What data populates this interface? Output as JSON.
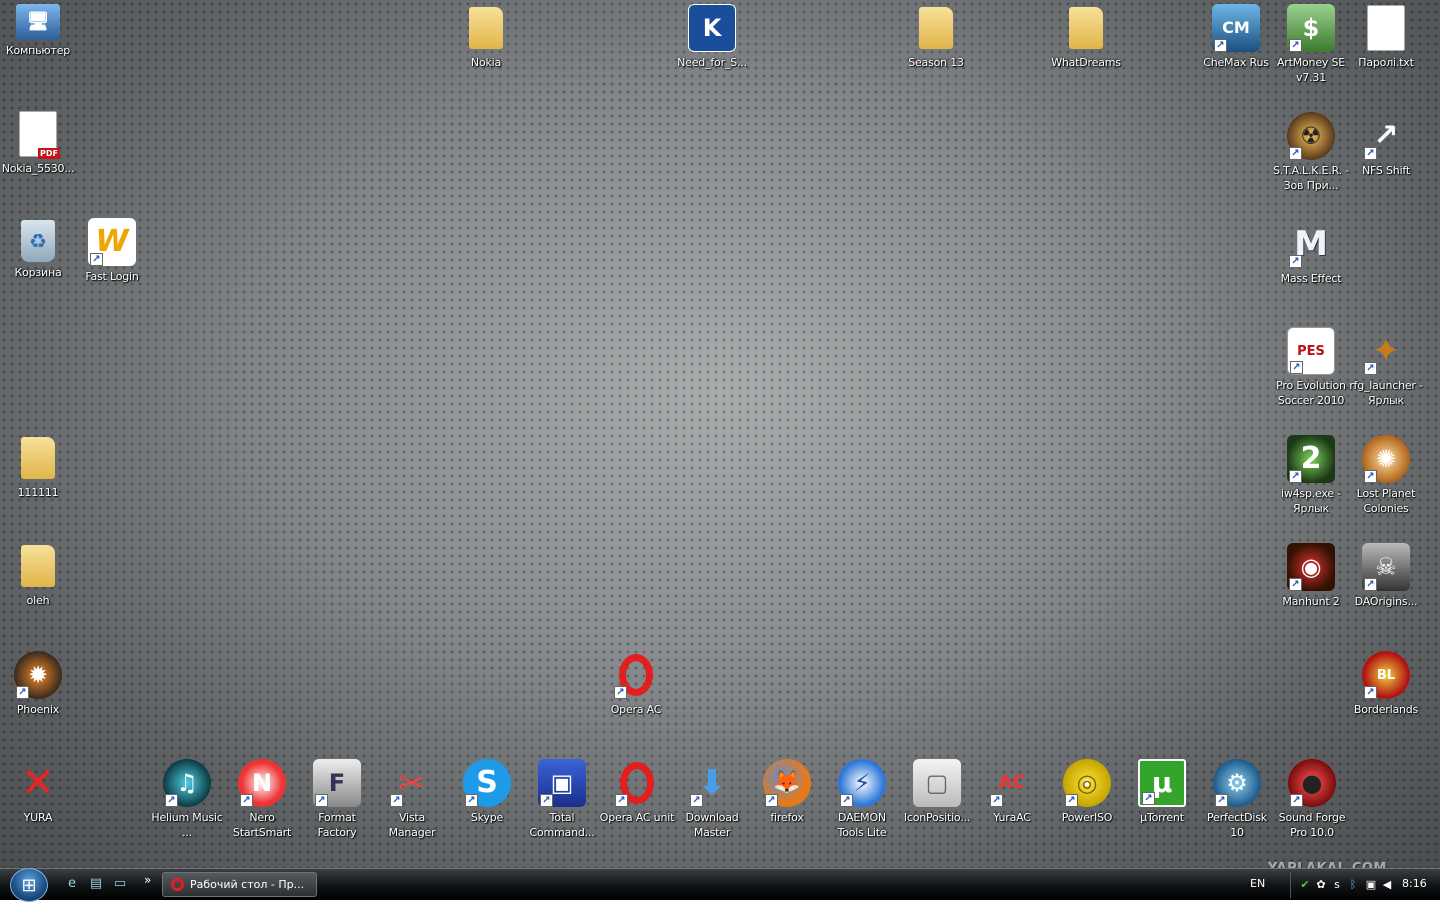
{
  "desktop": {
    "icons": [
      {
        "label": "Компьютер"
      },
      {
        "label": "Nokia"
      },
      {
        "label": "Need_for_S..."
      },
      {
        "label": "Season 13"
      },
      {
        "label": "WhatDreams"
      },
      {
        "label": "CheMax Rus"
      },
      {
        "label": "ArtMoney SE v7.31"
      },
      {
        "label": "Паролі.txt"
      },
      {
        "label": "Nokia_5530..."
      },
      {
        "label": "S.T.A.L.K.E.R. - Зов При..."
      },
      {
        "label": "NFS Shift"
      },
      {
        "label": "Корзина"
      },
      {
        "label": "Fast Login"
      },
      {
        "label": "Mass Effect"
      },
      {
        "label": "Pro Evolution Soccer 2010"
      },
      {
        "label": "rfg_launcher - Ярлык"
      },
      {
        "label": "111111"
      },
      {
        "label": "iw4sp.exe - Ярлык"
      },
      {
        "label": "Lost Planet Colonies"
      },
      {
        "label": "oleh"
      },
      {
        "label": "Manhunt 2"
      },
      {
        "label": "DAOrigins..."
      },
      {
        "label": "Phoenix"
      },
      {
        "label": "Opera AC"
      },
      {
        "label": "Borderlands"
      },
      {
        "label": "YURA"
      },
      {
        "label": "Helium Music ..."
      },
      {
        "label": "Nero StartSmart"
      },
      {
        "label": "Format Factory"
      },
      {
        "label": "Vista Manager"
      },
      {
        "label": "Skype"
      },
      {
        "label": "Total Command..."
      },
      {
        "label": "Opera AC unit"
      },
      {
        "label": "Download Master"
      },
      {
        "label": "firefox"
      },
      {
        "label": "DAEMON Tools Lite"
      },
      {
        "label": "IconPositio..."
      },
      {
        "label": "YuraAC"
      },
      {
        "label": "PowerISO"
      },
      {
        "label": "µTorrent"
      },
      {
        "label": "PerfectDisk 10"
      },
      {
        "label": "Sound Forge Pro 10.0"
      }
    ]
  },
  "icon_glyphs": {
    "computer": "🖥",
    "pdf": "PDF",
    "recycle": "♻",
    "fastlogin": "W",
    "chemax": "CM",
    "artmoney": "$",
    "stalker": "☢",
    "nfs": "↗",
    "mass": "M",
    "pes": "PES",
    "rfg": "✦",
    "iw4": "2",
    "lost": "✺",
    "manhunt": "◉",
    "dao": "☠",
    "phoenix": "✹",
    "opera": "O",
    "borderlands": "BL",
    "yura": "✕",
    "helium": "♫",
    "nero": "N",
    "format": "F",
    "vista": "✂",
    "skype": "S",
    "totalcmd": "▣",
    "download": "⬇",
    "firefox": "🦊",
    "daemon": "⚡",
    "iconpos": "▢",
    "yuraac": "AC",
    "poweriso": "◎",
    "utorrent": "µ",
    "perfectdisk": "⚙",
    "soundforge": "●",
    "shortcut": "↗",
    "k": "K"
  },
  "colors": {
    "opera": "#e21e1e",
    "skype": "#1e9be8",
    "utorrent": "#33a52a",
    "taskbar": "#101214",
    "accent": "#1c54b3"
  },
  "taskbar": {
    "start_icon": "windows-orb",
    "quicklaunch_chevron": "»",
    "window_button": "Рабочий стол - Пр...",
    "language": "EN",
    "clock": "8:16"
  },
  "watermark": "YAPLAKAL.COM"
}
